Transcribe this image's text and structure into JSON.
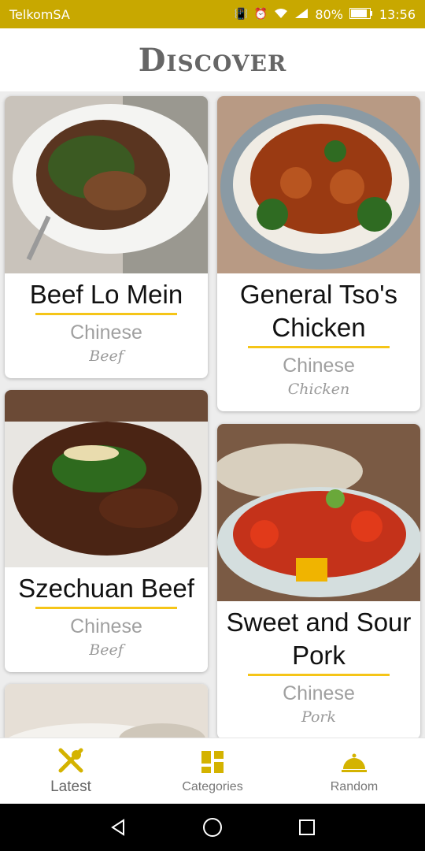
{
  "status": {
    "carrier": "TelkomSA",
    "battery": "80%",
    "time": "13:56"
  },
  "header": {
    "title": "Discover"
  },
  "cards": [
    {
      "name": "Beef Lo Mein",
      "cuisine": "Chinese",
      "category": "Beef"
    },
    {
      "name": "General Tso's Chicken",
      "cuisine": "Chinese",
      "category": "Chicken"
    },
    {
      "name": "Szechuan Beef",
      "cuisine": "Chinese",
      "category": "Beef"
    },
    {
      "name": "Sweet and Sour Pork",
      "cuisine": "Chinese",
      "category": "Pork"
    }
  ],
  "nav": {
    "latest": "Latest",
    "categories": "Categories",
    "random": "Random"
  },
  "colors": {
    "statusbar": "#c8a800",
    "accent": "#f5c518",
    "icon": "#d4b300"
  }
}
